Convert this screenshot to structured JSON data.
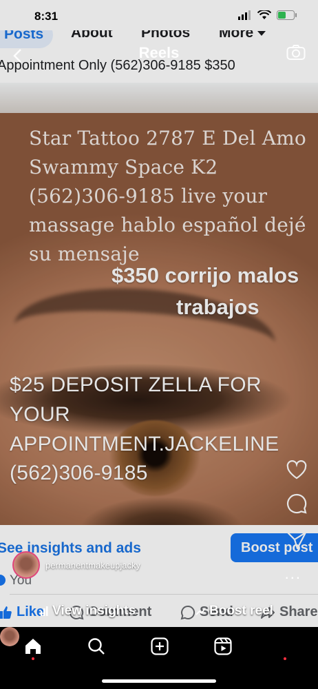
{
  "status": {
    "time": "8:31"
  },
  "profile_tabs": {
    "posts": "Posts",
    "about": "About",
    "photos": "Photos",
    "more": "More"
  },
  "post": {
    "text": "Appointment Only (562)306-9185 $350",
    "image_serif_lines": [
      "Star Tattoo 2787 E Del Amo",
      "Swammy Space K2",
      "(562)306-9185  live your",
      "massage hablo español dejé",
      "su mensaje"
    ],
    "image_price_lines": [
      "$350 corrijo malos",
      "trabajos"
    ],
    "image_deposit_lines": [
      "$25 DEPOSIT ZELLA FOR",
      "YOUR",
      "APPOINTMENT.JACKELINE",
      "(562)306-9185"
    ]
  },
  "insights": {
    "see_insights": "See insights and ads",
    "boost_post": "Boost post"
  },
  "reactions": {
    "you": "You"
  },
  "actions": {
    "like": "Like",
    "comment": "Comment",
    "send": "Send",
    "share": "Share"
  },
  "reels": {
    "title": "Reels",
    "username": "permanentmakeupjacky",
    "more": "...",
    "view_insights": "View insights",
    "boost_reel": "Boost reel"
  },
  "colors": {
    "accent": "#1877f2",
    "story_ring": "#e0457b",
    "notification_dot": "#ff3040"
  },
  "icons": {
    "reels": [
      "back-icon",
      "camera-icon",
      "heart-icon",
      "comment-icon",
      "send-icon",
      "insights-icon",
      "boost-icon"
    ],
    "tabbar": [
      "home-icon",
      "search-icon",
      "create-icon",
      "reels-icon",
      "profile-avatar"
    ]
  }
}
